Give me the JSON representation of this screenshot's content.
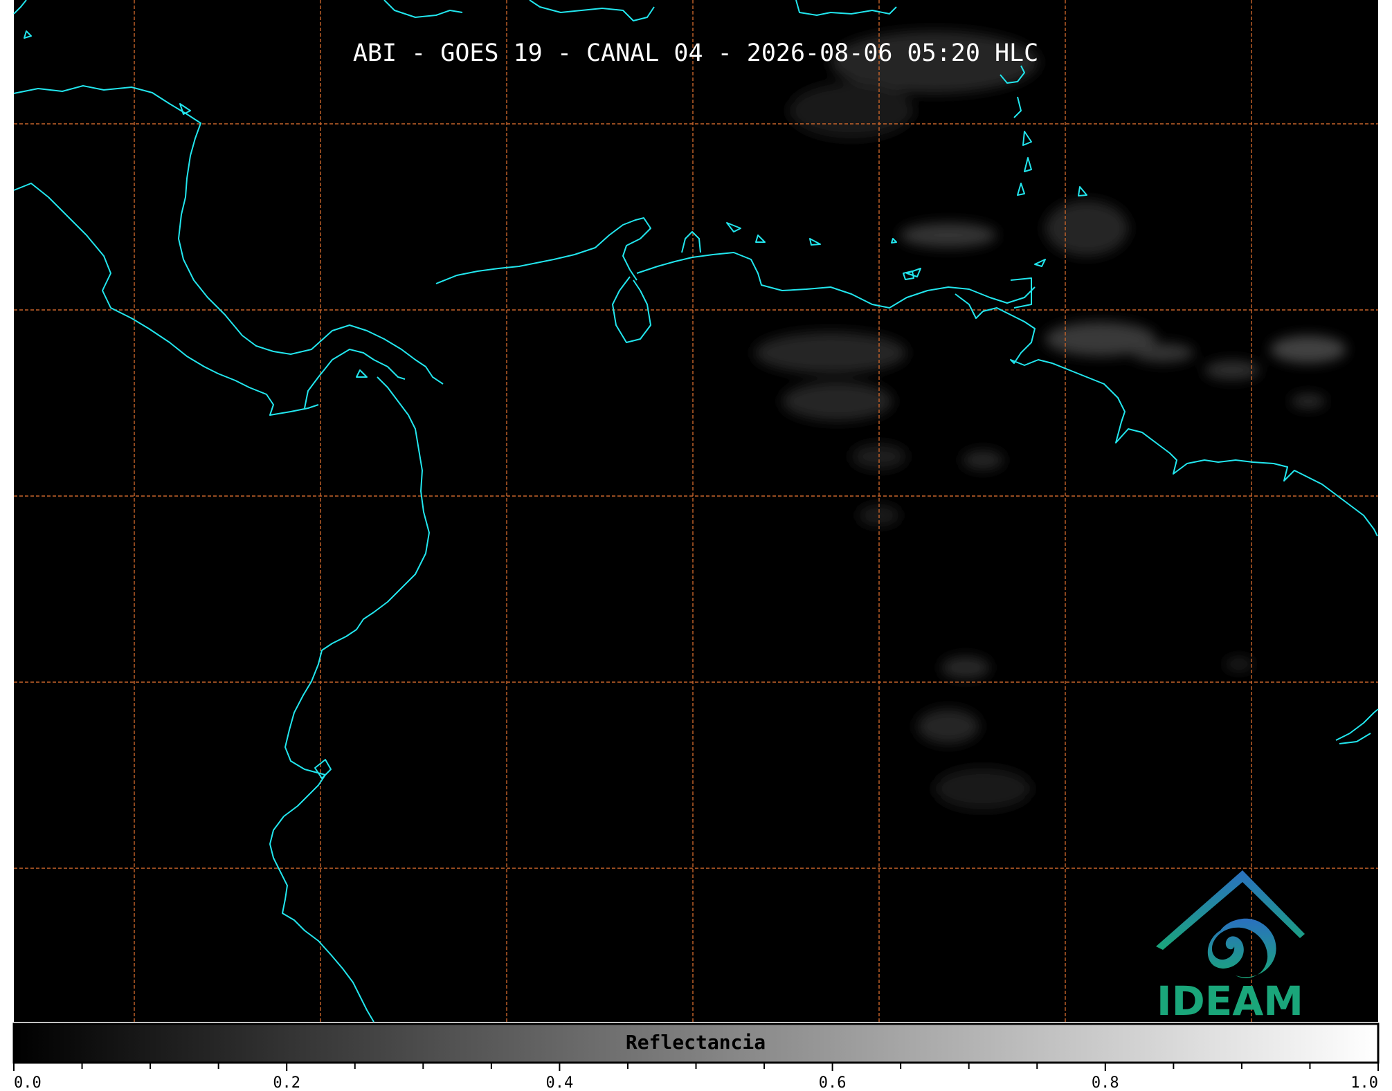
{
  "title": "ABI - GOES 19 - CANAL 04 - 2026-08-06 05:20 HLC",
  "colorbar": {
    "label": "Reflectancia",
    "ticks": [
      "0.0",
      "0.2",
      "0.4",
      "0.6",
      "0.8",
      "1.0"
    ],
    "min": 0.0,
    "max": 1.0,
    "colormap_start": "#000000",
    "colormap_end": "#ffffff"
  },
  "logo": {
    "text": "IDEAM",
    "color": "#1aa67a",
    "accent": "#2a7fb8"
  },
  "colors": {
    "background": "#000000",
    "coastline": "#22e6ee",
    "graticule": "#c8642a"
  },
  "map": {
    "graticule": "dashed",
    "coastlines": "on",
    "imagery": "visible reflectance (night, mostly dark)"
  }
}
